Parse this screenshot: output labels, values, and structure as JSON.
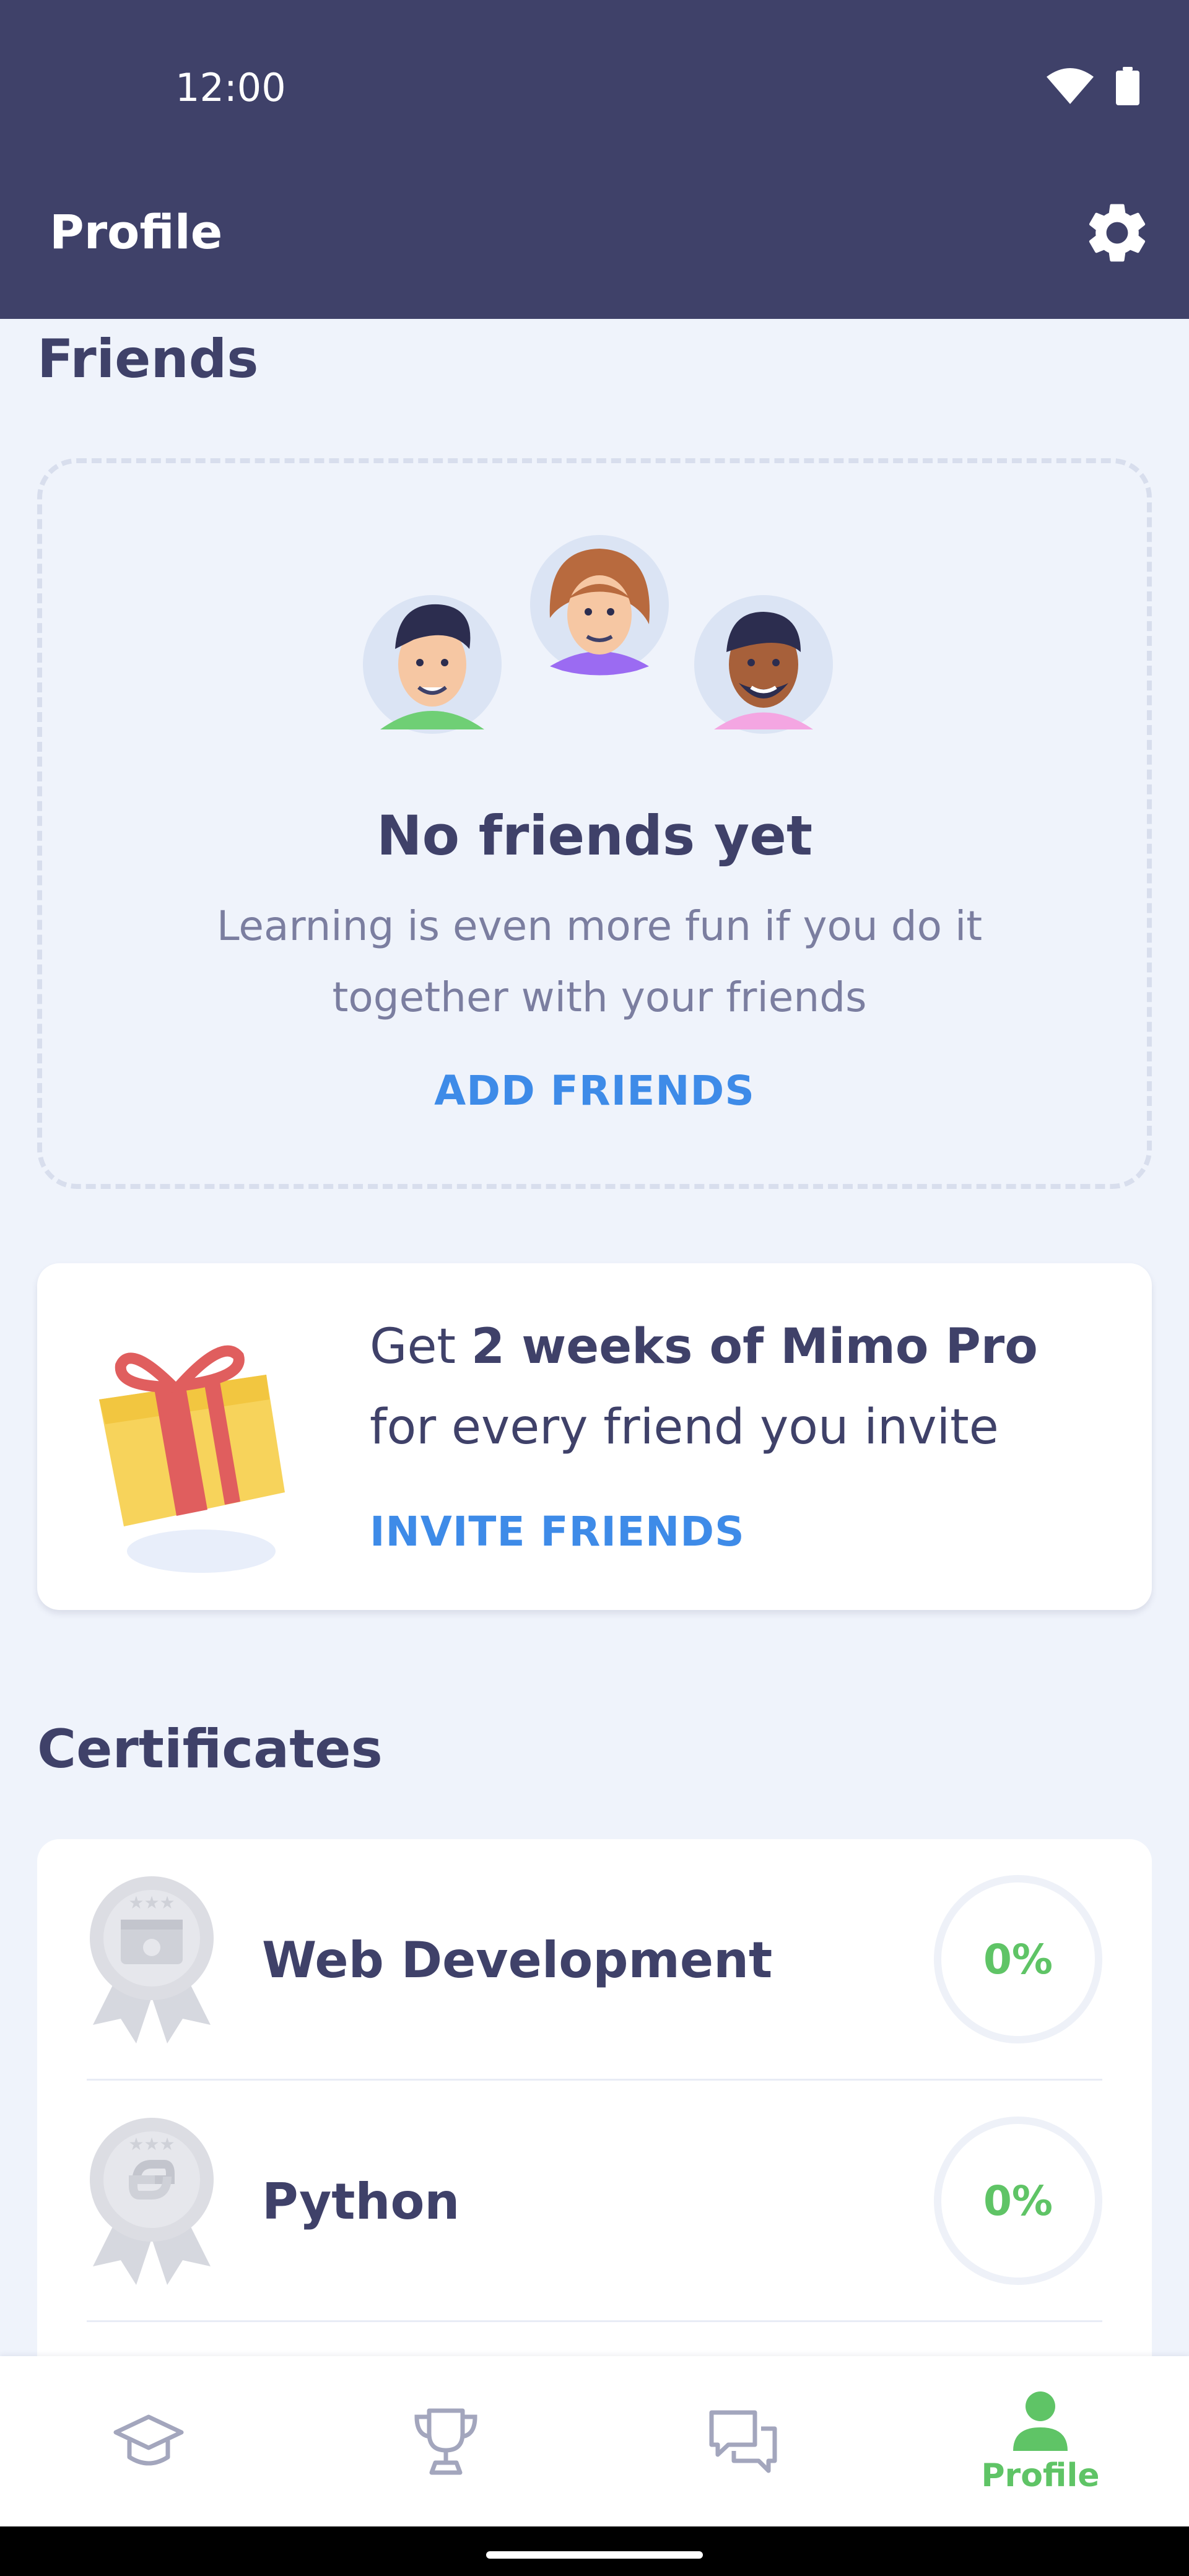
{
  "status": {
    "time": "12:00"
  },
  "appbar": {
    "title": "Profile"
  },
  "friends": {
    "section_title": "Friends",
    "empty_title": "No friends yet",
    "empty_subtitle": "Learning is even more fun if you do it together with your friends",
    "add_label": "ADD FRIENDS"
  },
  "invite": {
    "text_prefix": "Get ",
    "text_bold": "2 weeks of Mimo Pro",
    "text_suffix": " for every friend you invite",
    "link_label": "INVITE FRIENDS"
  },
  "certificates": {
    "section_title": "Certificates",
    "items": [
      {
        "name": "Web Development",
        "progress": "0%",
        "icon": "web-certificate-badge-icon"
      },
      {
        "name": "Python",
        "progress": "0%",
        "icon": "python-certificate-badge-icon"
      }
    ]
  },
  "bottom_nav": {
    "items": [
      {
        "icon": "graduation-cap-icon",
        "label": ""
      },
      {
        "icon": "trophy-icon",
        "label": ""
      },
      {
        "icon": "chat-bubbles-icon",
        "label": ""
      },
      {
        "icon": "profile-person-icon",
        "label": "Profile",
        "active": true
      }
    ]
  },
  "colors": {
    "header": "#3f4169",
    "background": "#eff3fb",
    "link_blue": "#3e8be8",
    "success_green": "#5fc466"
  }
}
